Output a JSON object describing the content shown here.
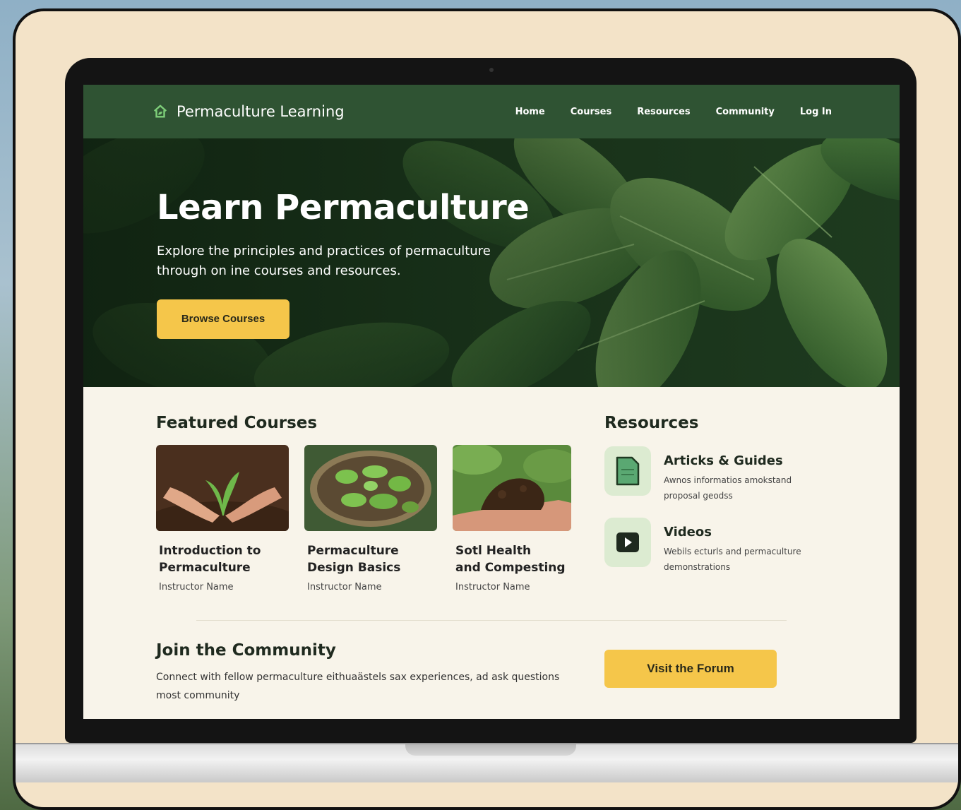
{
  "brand": {
    "name": "Permaculture Learning"
  },
  "nav": {
    "links": [
      "Home",
      "Courses",
      "Resources",
      "Community",
      "Log In"
    ]
  },
  "hero": {
    "title": "Learn Permaculture",
    "subtitle": "Explore the principles and practices of permaculture through on ine courses and resources.",
    "cta": "Browse Courses"
  },
  "featured": {
    "title": "Featured Courses",
    "courses": [
      {
        "title_line1": "Introduction to",
        "title_line2": "Permaculture",
        "instructor": "Instructor Name"
      },
      {
        "title_line1": "Permaculture",
        "title_line2": "Design Basics",
        "instructor": "Instructor Name"
      },
      {
        "title_line1": "Sotl Health",
        "title_line2": "and Compesting",
        "instructor": "Instructor Name"
      }
    ]
  },
  "resources": {
    "title": "Resources",
    "items": [
      {
        "title": "Articks & Guides",
        "desc": "Awnos informatios amokstand proposal geodss"
      },
      {
        "title": "Videos",
        "desc": "Webils ecturls and permaculture demonstrations"
      }
    ]
  },
  "community": {
    "title": "Join the Community",
    "desc": "Connect with fellow permaculture eithuaästels sax experiences, ad ask questions most community",
    "cta": "Visit the Forum"
  },
  "colors": {
    "nav_bg": "#2f5333",
    "accent_yellow": "#f5c64a",
    "page_bg": "#f8f4ea",
    "icon_bg": "#dcebd1"
  }
}
